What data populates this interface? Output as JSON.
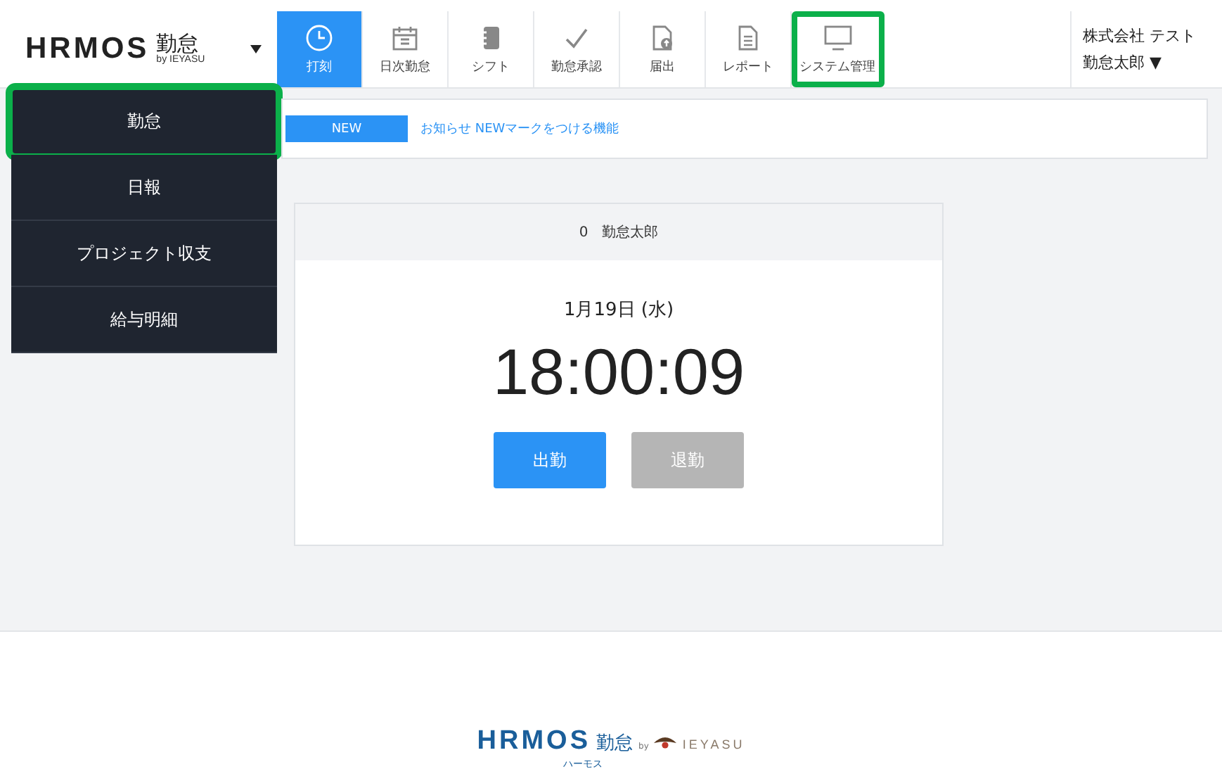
{
  "header": {
    "logo": {
      "wordmark": "HRMOS",
      "product": "勤怠",
      "byline": "by IEYASU"
    },
    "tabs": [
      {
        "label": "打刻",
        "kind": "clock",
        "selected": true,
        "highlighted": false
      },
      {
        "label": "日次勤怠",
        "kind": "calendar",
        "selected": false,
        "highlighted": false
      },
      {
        "label": "シフト",
        "kind": "notebook",
        "selected": false,
        "highlighted": false
      },
      {
        "label": "勤怠承認",
        "kind": "check",
        "selected": false,
        "highlighted": false
      },
      {
        "label": "届出",
        "kind": "upload",
        "selected": false,
        "highlighted": false
      },
      {
        "label": "レポート",
        "kind": "document",
        "selected": false,
        "highlighted": false
      },
      {
        "label": "システム管理",
        "kind": "monitor",
        "selected": false,
        "highlighted": true
      }
    ],
    "user": {
      "company": "株式会社 テスト",
      "name": "勤怠太郎 ▼"
    }
  },
  "sidebar": {
    "items": [
      {
        "label": "勤怠",
        "highlighted": true
      },
      {
        "label": "日報",
        "highlighted": false
      },
      {
        "label": "プロジェクト収支",
        "highlighted": false
      },
      {
        "label": "給与明細",
        "highlighted": false
      }
    ]
  },
  "notice": {
    "badge": "NEW",
    "text": "お知らせ NEWマークをつける機能"
  },
  "clock_card": {
    "employee_number": "0",
    "employee_name": "勤怠太郎",
    "date": "1月19日 (水)",
    "time": "18:00:09",
    "buttons": [
      {
        "label": "出勤",
        "disabled": false
      },
      {
        "label": "退勤",
        "disabled": true
      }
    ]
  },
  "footer": {
    "wordmark": "HRMOS",
    "product": "勤怠",
    "by": "by",
    "brand": "IEYASU",
    "reading": "ハーモス"
  }
}
